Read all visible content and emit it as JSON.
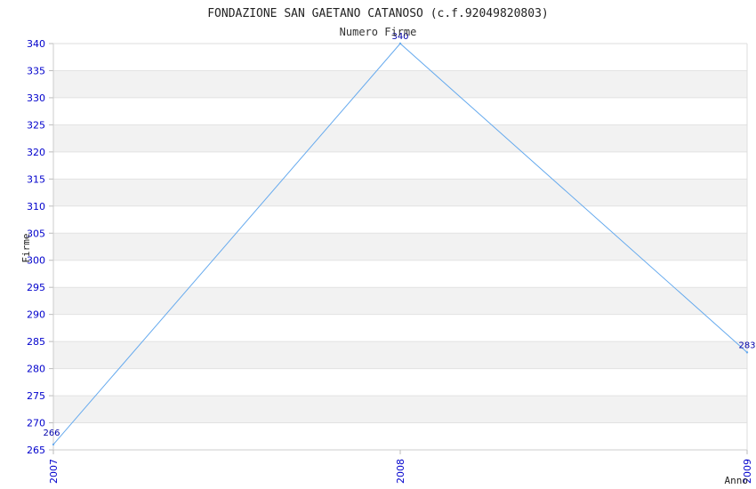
{
  "chart_data": {
    "type": "line",
    "title": "FONDAZIONE SAN GAETANO CATANOSO (c.f.92049820803)",
    "subtitle": "Numero Firme",
    "xlabel": "Anno",
    "ylabel": "Firme",
    "x": [
      "2007",
      "2008",
      "2009"
    ],
    "series": [
      {
        "values": [
          266,
          340,
          283
        ],
        "color": "#66aaee"
      }
    ],
    "data_labels": [
      "266",
      "340",
      "283"
    ],
    "ylim": [
      265,
      340
    ],
    "yticks": [
      265,
      270,
      275,
      280,
      285,
      290,
      295,
      300,
      305,
      310,
      315,
      320,
      325,
      330,
      335,
      340
    ],
    "grid": "horizontal",
    "band_colors": [
      "#ffffff",
      "#f2f2f2"
    ],
    "tick_color": "#0000cc",
    "label_color": "#0000aa"
  }
}
